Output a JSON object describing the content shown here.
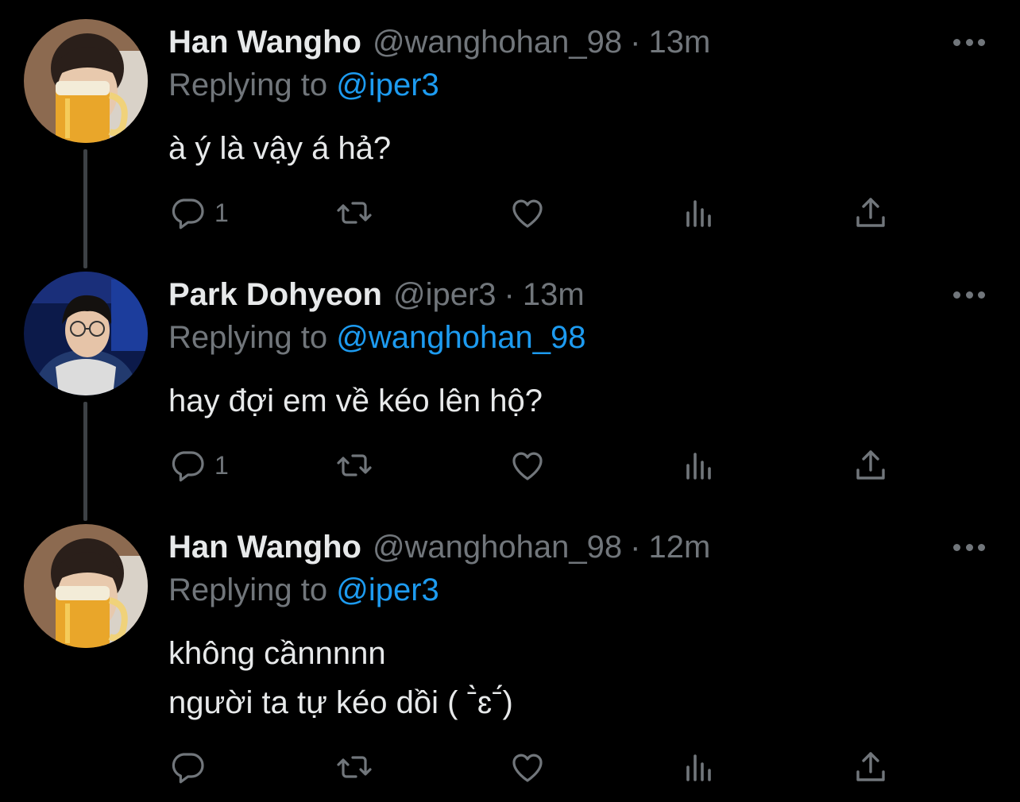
{
  "tweets": [
    {
      "name": "Han Wangho",
      "handle": "@wanghohan_98",
      "separator": "·",
      "time": "13m",
      "replying_prefix": "Replying to",
      "replying_to": "@iper3",
      "lines": [
        "à ý là vậy á hả?"
      ],
      "reply_count": "1",
      "avatar": "beer-mug-selfie-avatar"
    },
    {
      "name": "Park Dohyeon",
      "handle": "@iper3",
      "separator": "·",
      "time": "13m",
      "replying_prefix": "Replying to",
      "replying_to": "@wanghohan_98",
      "lines": [
        "hay đợi em về kéo lên hộ?"
      ],
      "reply_count": "1",
      "avatar": "glasses-hoodie-avatar"
    },
    {
      "name": "Han Wangho",
      "handle": "@wanghohan_98",
      "separator": "·",
      "time": "12m",
      "replying_prefix": "Replying to",
      "replying_to": "@iper3",
      "lines": [
        "không cầnnnnn",
        "người ta tự kéo dồi ( ˉ̀ɛˉ́)"
      ],
      "reply_count": "",
      "avatar": "beer-mug-selfie-avatar"
    }
  ],
  "icons": {
    "reply": "reply-icon",
    "retweet": "retweet-icon",
    "like": "like-icon",
    "views": "views-icon",
    "share": "share-icon",
    "more": "more-icon"
  },
  "colors": {
    "background": "#000000",
    "primary_text": "#e7e9ea",
    "secondary_text": "#71767b",
    "mention": "#1d9bf0",
    "thread_line": "#3d4145"
  }
}
